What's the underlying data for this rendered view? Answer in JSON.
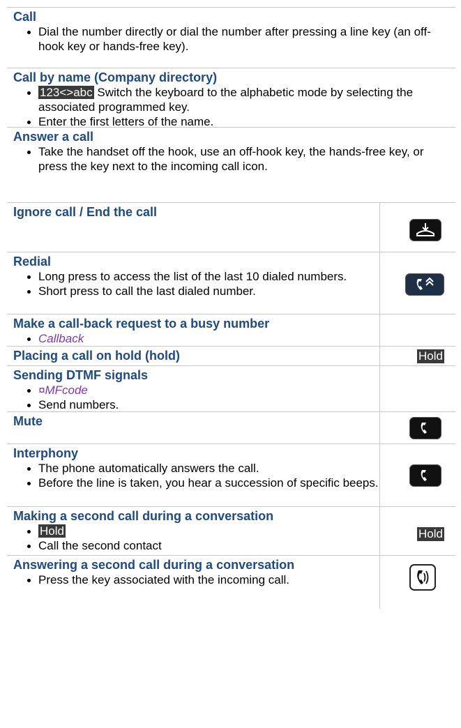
{
  "rows": [
    {
      "title": "Call",
      "items": [
        "Dial the number directly or dial the number after pressing a line key (an off-hook key or hands-free key)."
      ]
    },
    {
      "title": "Call by name (Company directory)",
      "key_tag": "123<>abc",
      "items_after_tag": "Switch the keyboard to the alphabetic mode by selecting the associated programmed key.",
      "items": [
        "Enter the first letters of the name."
      ]
    },
    {
      "title": "Answer a call",
      "items": [
        "Take the handset off the hook, use an off-hook key, the hands-free key, or press the key next to the incoming call icon."
      ]
    },
    {
      "title": "Ignore call / End the call",
      "icon": "hang-up-icon"
    },
    {
      "title": "Redial",
      "icon": "redial-icon",
      "items": [
        "Long press to access the list of the last 10 dialed numbers.",
        "Short press to call the last dialed number."
      ]
    },
    {
      "title": "Make a call-back request to a busy number",
      "items": [
        "Callback"
      ]
    },
    {
      "title": "Placing a call on hold (hold)",
      "tag": "Hold"
    },
    {
      "title": "Sending DTMF signals",
      "items": [
        "¤MFcode",
        "Send numbers."
      ]
    },
    {
      "title": "Mute",
      "icon": "mute-icon"
    },
    {
      "title": "Interphony",
      "icon": "interphony-icon",
      "items": [
        "The phone automatically answers the call.",
        "Before the line is taken, you hear a succession of specific beeps."
      ]
    },
    {
      "title": "Making a second call during a conversation",
      "tag": "Hold",
      "items": [
        "Hold",
        "Call the second contact"
      ]
    },
    {
      "title": "Answering a second call during a conversation",
      "icon": "incoming-call-icon",
      "items": [
        "Press the key associated with the incoming call."
      ]
    }
  ],
  "colors": {
    "heading": "#1e4a86",
    "option": "#7a3ab0",
    "tag_bg": "#3a3a3a"
  }
}
